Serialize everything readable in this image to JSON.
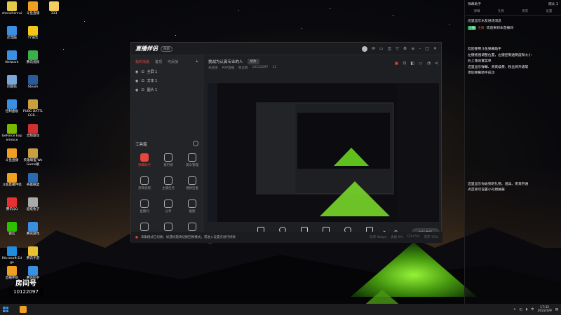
{
  "desktop": {
    "icons": [
      {
        "label": "shenchenrui",
        "color": "#e6c84a"
      },
      {
        "label": "斗鱼直播",
        "color": "#f0a020"
      },
      {
        "label": "333",
        "color": "#f5d060"
      },
      {
        "label": "此电脑",
        "color": "#3b8fe0"
      },
      {
        "label": "YY语音",
        "color": "#f5c518"
      },
      {
        "label": "Network",
        "color": "#3b8fe0"
      },
      {
        "label": "腾讯视频",
        "color": "#39b04a"
      },
      {
        "label": "回收站",
        "color": "#7aa6d8"
      },
      {
        "label": "Steam",
        "color": "#2a5a9a"
      },
      {
        "label": "控制面板",
        "color": "#3b8fe0"
      },
      {
        "label": "PUBG BATTLEGR...",
        "color": "#c8a040"
      },
      {
        "label": "GeForce Experience",
        "color": "#76b900"
      },
      {
        "label": "音频驱动",
        "color": "#d03030"
      },
      {
        "label": "斗鱼直播",
        "color": "#f0a020"
      },
      {
        "label": "英雄联盟 WeGame版",
        "color": "#c8a040"
      },
      {
        "label": "斗鱼直播伴侣",
        "color": "#f0a020"
      },
      {
        "label": "英雄联盟",
        "color": "#2a6ab0"
      },
      {
        "label": "腾讯QQ",
        "color": "#e83030"
      },
      {
        "label": "超级兔子",
        "color": "#aaaaaa"
      },
      {
        "label": "微信",
        "color": "#2dc100"
      },
      {
        "label": "腾讯游戏",
        "color": "#3b8fe0"
      },
      {
        "label": "Microsoft Edge",
        "color": "#1f8ce0"
      },
      {
        "label": "腾讯手游",
        "color": "#e8c030"
      },
      {
        "label": "直播伴侣",
        "color": "#f0a020"
      },
      {
        "label": "腾讯助手",
        "color": "#3b8fe0"
      }
    ],
    "room_label": "房间号",
    "room_number": "10122097"
  },
  "app": {
    "logo": "直播伴侣",
    "logo_badge": "体验",
    "sidebar": {
      "tabs": [
        "我的场景",
        "置顶",
        "可添加"
      ],
      "sources": [
        "全屏 1",
        "文本 1",
        "图片 1"
      ],
      "tools_title": "工具箱",
      "tools": [
        "弹幕助手",
        "排行榜",
        "观众管理",
        "贵宾权限",
        "主播任务",
        "视频连麦",
        "直播间",
        "分享",
        "截图",
        "新闻",
        "幸运",
        "公告"
      ]
    },
    "room_title": "挑战为认真专业的人",
    "room_edit": "修改",
    "meta": [
      "未选择",
      "PVP直播",
      "粉丝数",
      "10122097",
      "11"
    ],
    "controls": [
      "直播画面",
      "摄像头",
      "手机投屏",
      "多媒体",
      "麦克风",
      "扬声器"
    ],
    "start_label": "开始直播",
    "notice": "采集模式已切换，如遇问题请切换回原模式，或进入设置页进行修改",
    "stats": [
      "码率 0kbps",
      "丢帧 0%",
      "CPU 5%",
      "内存 35%"
    ]
  },
  "danmaku": {
    "title": "弹幕助手",
    "count": "观众 1",
    "tabs": [
      "弹幕",
      "礼物",
      "贵宾",
      "设置"
    ],
    "lines": [
      {
        "text": "这里显示水友进场消息",
        "color": "#ffffff"
      },
      {
        "text": "欢迎来到本直播间",
        "color": "#ffffff",
        "badge": "主播",
        "badge_color": "#2cae5b",
        "user": "主播"
      },
      {
        "text": "欢迎使用斗鱼弹幕助手",
        "color": "#ffffff"
      },
      {
        "text": "左键拖拽调整位置，左键控制透明度和大小",
        "color": "#ffffff"
      },
      {
        "text": "右上角设置菜单",
        "color": "#ffffff"
      },
      {
        "text": "这里显示弹幕、贵宾续费、粉丝牌升级等",
        "color": "#ffffff"
      },
      {
        "text": "添加弹幕助手成功",
        "color": "#ffffff"
      },
      {
        "text": "这里显示你收到的礼物、道具、贵宾开通",
        "color": "#ffffff"
      },
      {
        "text": "点菜单可设置小礼物屏蔽",
        "color": "#ffffff"
      }
    ]
  },
  "taskbar": {
    "time": "17:32",
    "date": "2022/4/9",
    "lang": "中"
  }
}
